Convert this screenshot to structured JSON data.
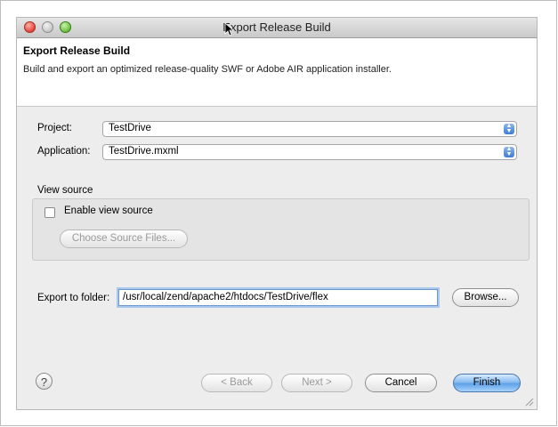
{
  "window": {
    "title": "Export Release Build"
  },
  "header": {
    "title": "Export Release Build",
    "description": "Build and export an optimized release-quality SWF or Adobe AIR application installer."
  },
  "project": {
    "label": "Project:",
    "value": "TestDrive"
  },
  "application": {
    "label": "Application:",
    "value": "TestDrive.mxml"
  },
  "view_source": {
    "group_title": "View source",
    "checkbox_label": "Enable view source",
    "checked": false,
    "choose_button": "Choose Source Files..."
  },
  "export": {
    "label": "Export to folder:",
    "path": "/usr/local/zend/apache2/htdocs/TestDrive/flex",
    "browse_button": "Browse..."
  },
  "footer": {
    "help_icon": "?",
    "back_button": "< Back",
    "next_button": "Next >",
    "cancel_button": "Cancel",
    "finish_button": "Finish"
  },
  "icons": [
    "close-icon",
    "minimize-icon",
    "zoom-icon",
    "mouse-cursor-icon",
    "chevron-updown-icon",
    "help-icon",
    "resize-grip-icon"
  ]
}
